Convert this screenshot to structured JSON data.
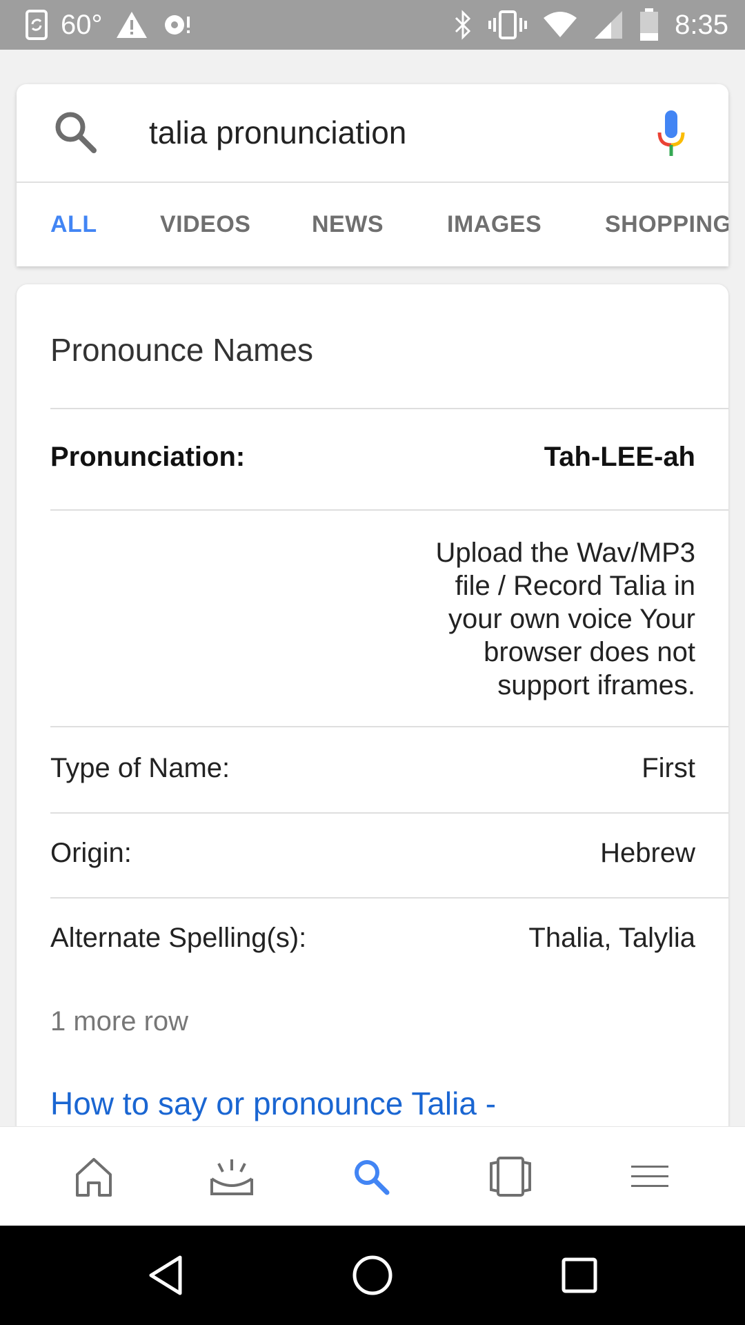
{
  "status_bar": {
    "temperature": "60°",
    "time": "8:35",
    "left_icons": [
      "phone-sync-icon",
      "warning-icon",
      "sync-icon"
    ],
    "right_icons": [
      "bluetooth-icon",
      "vibrate-icon",
      "wifi-icon",
      "cell-signal-icon",
      "battery-icon"
    ]
  },
  "search": {
    "query": "talia pronunciation",
    "icons": [
      "search-icon",
      "microphone-icon"
    ]
  },
  "tabs": [
    {
      "label": "ALL",
      "active": true
    },
    {
      "label": "VIDEOS",
      "active": false
    },
    {
      "label": "NEWS",
      "active": false
    },
    {
      "label": "IMAGES",
      "active": false
    },
    {
      "label": "SHOPPING",
      "active": false
    }
  ],
  "result": {
    "title": "Pronounce Names",
    "pronunciation": {
      "label": "Pronunciation:",
      "value": "Tah-LEE-ah"
    },
    "upload_text": "Upload the Wav/MP3 file / Record Talia in your own voice Your browser does not support iframes.",
    "rows": [
      {
        "label": "Type of Name:",
        "value": "First"
      },
      {
        "label": "Origin:",
        "value": "Hebrew"
      },
      {
        "label": "Alternate Spelling(s):",
        "value": "Thalia, Talylia"
      }
    ],
    "more_rows": "1 more row",
    "link": "How to say or pronounce Talia -"
  },
  "bottom_nav": {
    "items": [
      "home-icon",
      "updates-icon",
      "search-icon",
      "recent-tabs-icon",
      "menu-icon"
    ],
    "active_index": 2,
    "accent_color": "#4285f4"
  },
  "system_nav": [
    "back-icon",
    "home-circle-icon",
    "recents-icon"
  ]
}
